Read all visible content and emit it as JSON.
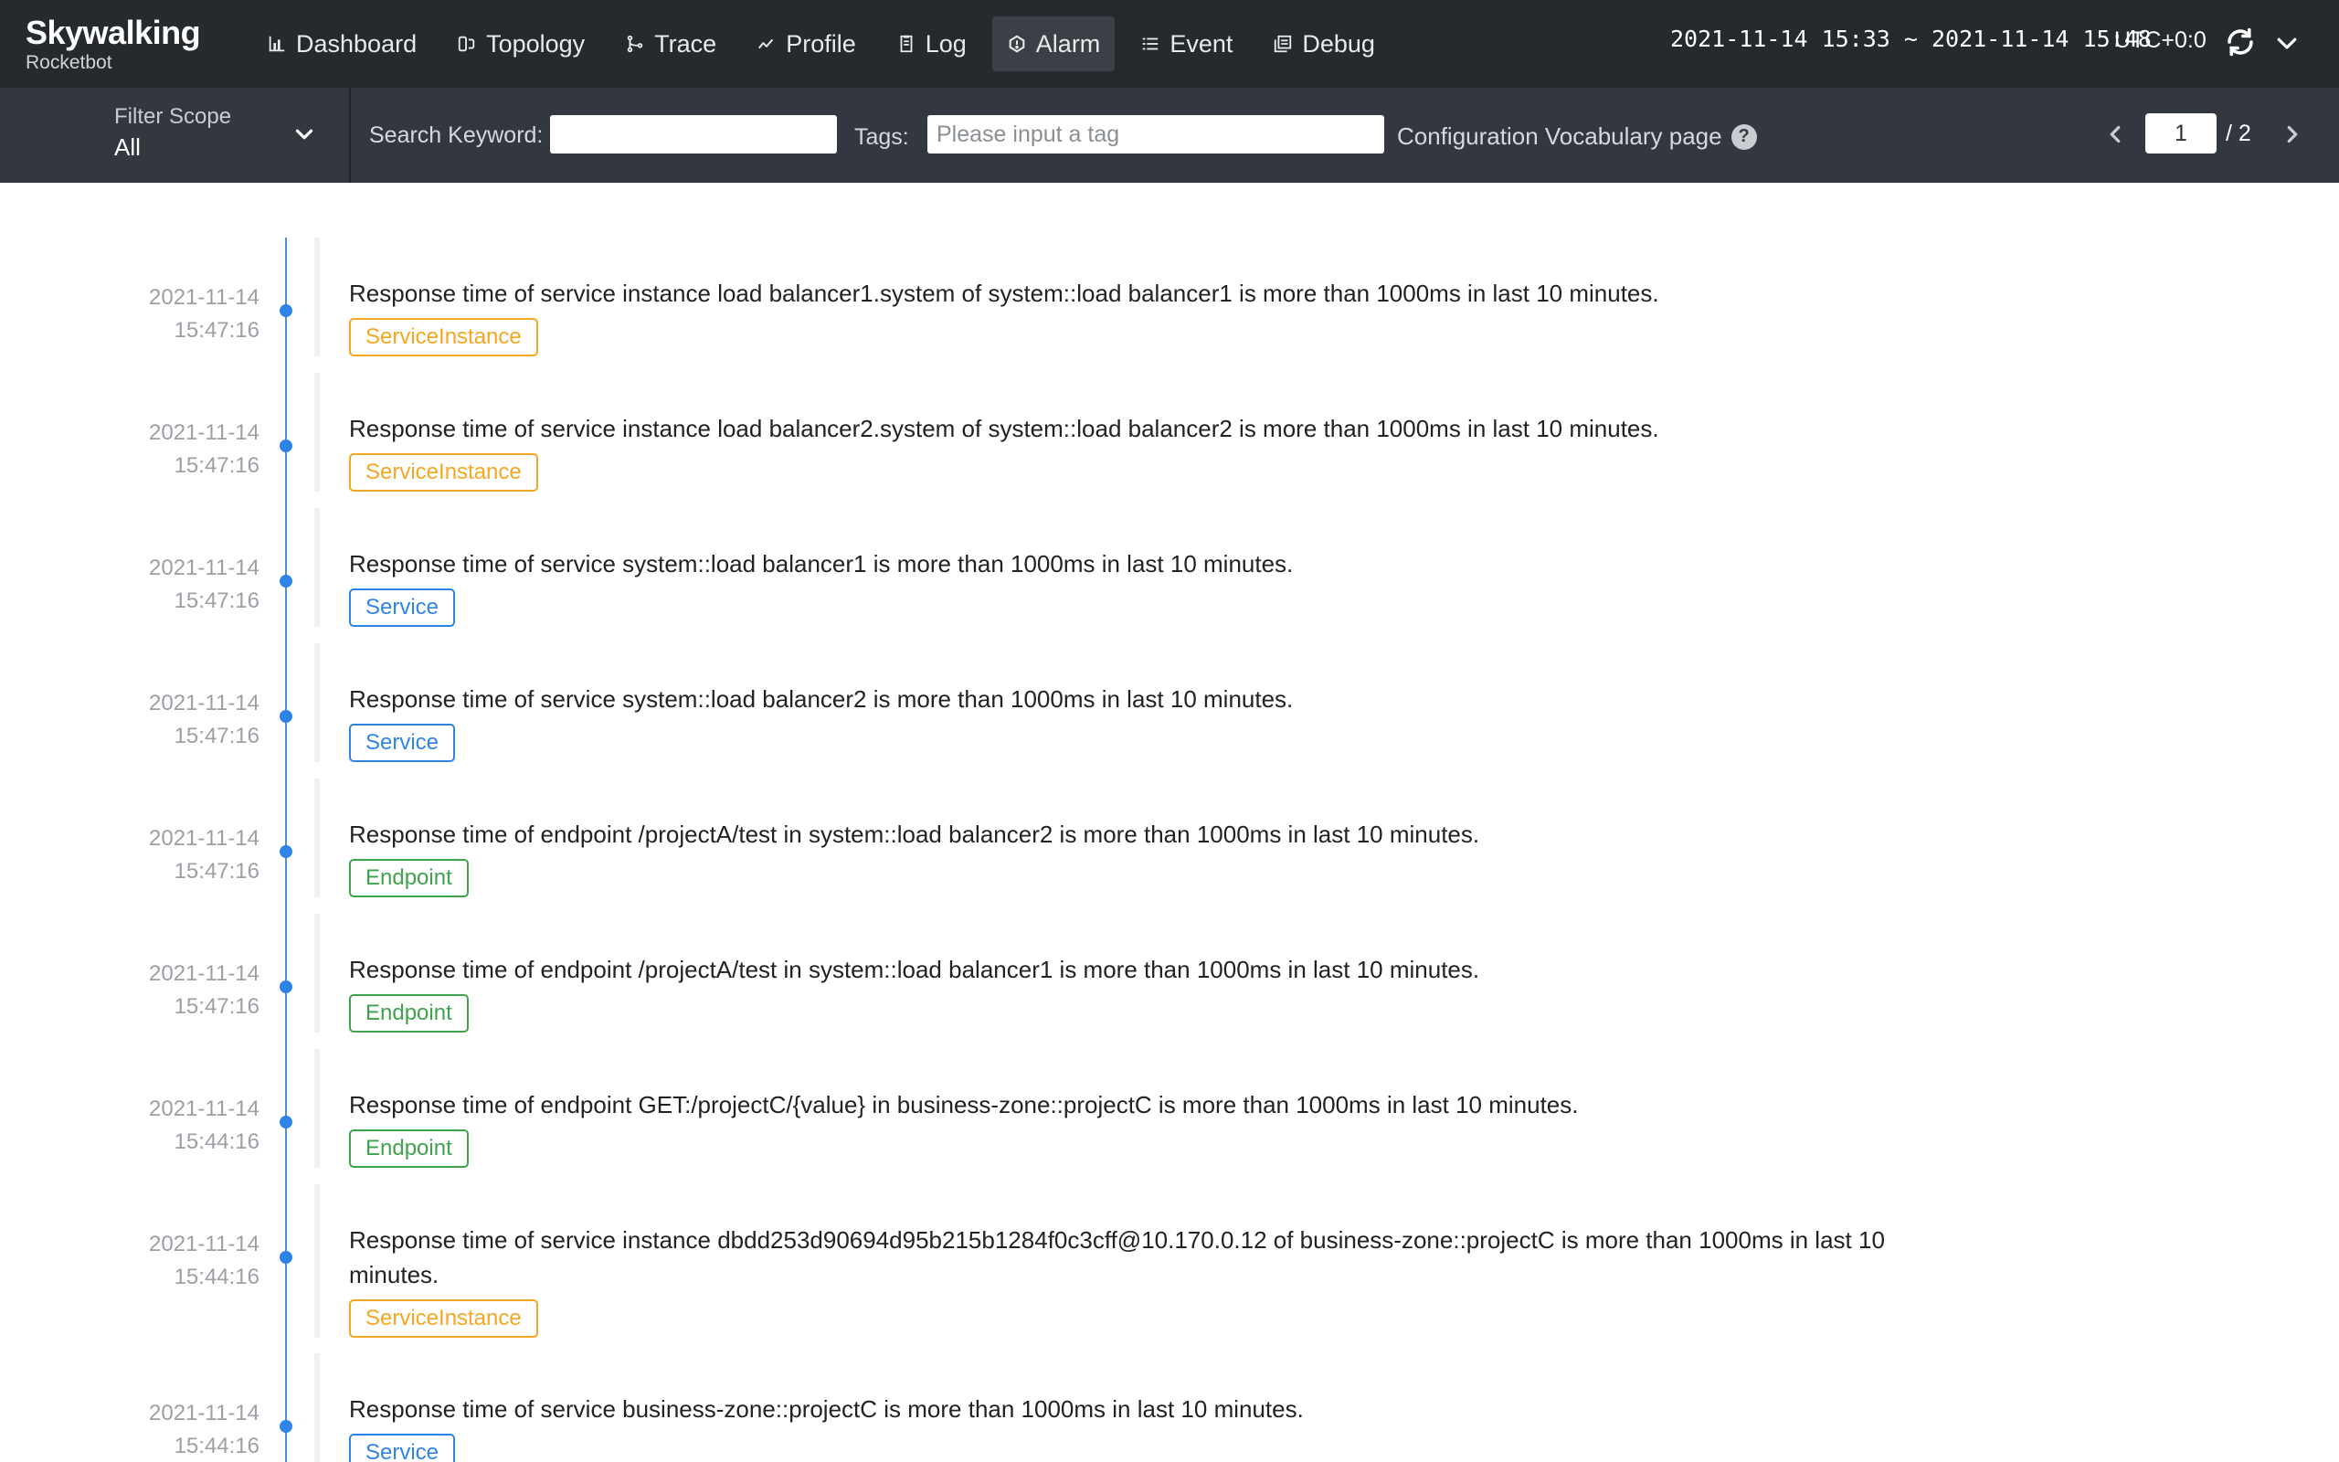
{
  "app": {
    "logo_name": "Skywalking",
    "logo_sub": "Rocketbot"
  },
  "nav": [
    {
      "label": "Dashboard",
      "icon": "bar-chart-icon",
      "active": false
    },
    {
      "label": "Topology",
      "icon": "topology-icon",
      "active": false
    },
    {
      "label": "Trace",
      "icon": "trace-icon",
      "active": false
    },
    {
      "label": "Profile",
      "icon": "profile-icon",
      "active": false
    },
    {
      "label": "Log",
      "icon": "log-icon",
      "active": false
    },
    {
      "label": "Alarm",
      "icon": "alarm-icon",
      "active": true
    },
    {
      "label": "Event",
      "icon": "list-icon",
      "active": false
    },
    {
      "label": "Debug",
      "icon": "debug-icon",
      "active": false
    }
  ],
  "header": {
    "time_range": "2021-11-14 15:33 ~ 2021-11-14 15:48",
    "timezone": "UTC+0:0"
  },
  "filters": {
    "scope_label": "Filter Scope",
    "scope_value": "All",
    "search_label": "Search Keyword:",
    "search_value": "",
    "tags_label": "Tags:",
    "tags_placeholder": "Please input a tag",
    "vocab_link": "Configuration Vocabulary page"
  },
  "pagination": {
    "current": "1",
    "total": "/ 2"
  },
  "colors": {
    "ServiceInstance": "#f5a623",
    "Service": "#2f84e8",
    "Endpoint": "#3fa34d"
  },
  "alarms": [
    {
      "date": "2021-11-14",
      "time": "15:47:16",
      "message": "Response time of service instance load balancer1.system of system::load balancer1 is more than 1000ms in last 10 minutes.",
      "scope": "ServiceInstance"
    },
    {
      "date": "2021-11-14",
      "time": "15:47:16",
      "message": "Response time of service instance load balancer2.system of system::load balancer2 is more than 1000ms in last 10 minutes.",
      "scope": "ServiceInstance"
    },
    {
      "date": "2021-11-14",
      "time": "15:47:16",
      "message": "Response time of service system::load balancer1 is more than 1000ms in last 10 minutes.",
      "scope": "Service"
    },
    {
      "date": "2021-11-14",
      "time": "15:47:16",
      "message": "Response time of service system::load balancer2 is more than 1000ms in last 10 minutes.",
      "scope": "Service"
    },
    {
      "date": "2021-11-14",
      "time": "15:47:16",
      "message": "Response time of endpoint /projectA/test in system::load balancer2 is more than 1000ms in last 10 minutes.",
      "scope": "Endpoint"
    },
    {
      "date": "2021-11-14",
      "time": "15:47:16",
      "message": "Response time of endpoint /projectA/test in system::load balancer1 is more than 1000ms in last 10 minutes.",
      "scope": "Endpoint"
    },
    {
      "date": "2021-11-14",
      "time": "15:44:16",
      "message": "Response time of endpoint GET:/projectC/{value} in business-zone::projectC is more than 1000ms in last 10 minutes.",
      "scope": "Endpoint"
    },
    {
      "date": "2021-11-14",
      "time": "15:44:16",
      "message": "Response time of service instance dbdd253d90694d95b215b1284f0c3cff@10.170.0.12 of business-zone::projectC is more than 1000ms in last 10 minutes.",
      "scope": "ServiceInstance"
    },
    {
      "date": "2021-11-14",
      "time": "15:44:16",
      "message": "Response time of service business-zone::projectC is more than 1000ms in last 10 minutes.",
      "scope": "Service"
    }
  ]
}
